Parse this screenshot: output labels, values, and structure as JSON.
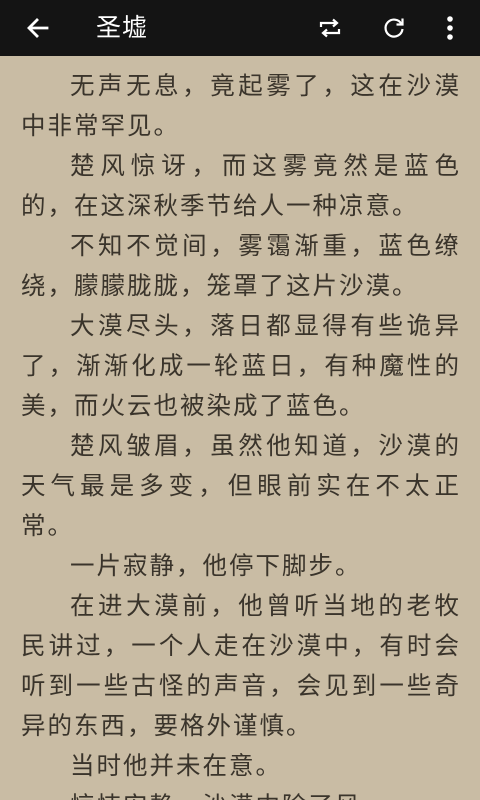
{
  "header": {
    "title": "圣墟",
    "icons": {
      "back": "back-arrow-icon",
      "repeat": "repeat-icon",
      "refresh": "refresh-icon",
      "more": "more-vertical-icon"
    }
  },
  "colors": {
    "toolbar_bg": "#141414",
    "page_bg": "#c9bca4",
    "text": "#3a342b"
  },
  "reader": {
    "paragraphs": [
      "无声无息，竟起雾了，这在沙漠中非常罕见。",
      "楚风惊讶，而这雾竟然是蓝色的，在这深秋季节给人一种凉意。",
      "不知不觉间，雾霭渐重，蓝色缭绕，朦朦胧胧，笼罩了这片沙漠。",
      "大漠尽头，落日都显得有些诡异了，渐渐化成一轮蓝日，有种魔性的美，而火云也被染成了蓝色。",
      "楚风皱眉，虽然他知道，沙漠的天气最是多变，但眼前实在不太正常。",
      "一片寂静，他停下脚步。",
      "在进大漠前，他曾听当地的老牧民讲过，一个人走在沙漠中，有时会听到一些古怪的声音，会见到一些奇异的东西，要格外谨慎。",
      "当时他并未在意。",
      "惊悚安静，沙漠中除了风..."
    ]
  }
}
